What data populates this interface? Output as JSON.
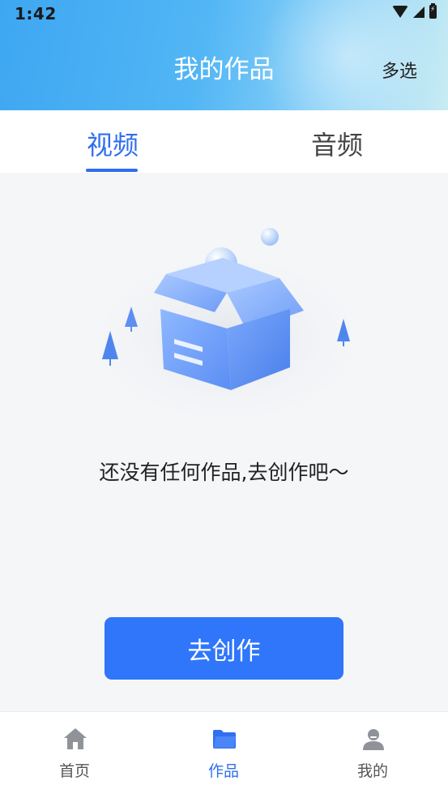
{
  "status_bar": {
    "time": "1:42"
  },
  "header": {
    "title": "我的作品",
    "multi_select_label": "多选"
  },
  "tabs": [
    {
      "label": "视频",
      "active": true
    },
    {
      "label": "音频",
      "active": false
    }
  ],
  "empty_state": {
    "message": "还没有任何作品,去创作吧～",
    "button_label": "去创作"
  },
  "bottom_nav": [
    {
      "label": "首页",
      "icon": "home-icon",
      "active": false
    },
    {
      "label": "作品",
      "icon": "folder-icon",
      "active": true
    },
    {
      "label": "我的",
      "icon": "user-icon",
      "active": false
    }
  ],
  "colors": {
    "accent": "#2f6ff0",
    "button": "#2f76fb",
    "header_gradient_start": "#3ea7f2",
    "header_gradient_end": "#c9ecf3"
  }
}
